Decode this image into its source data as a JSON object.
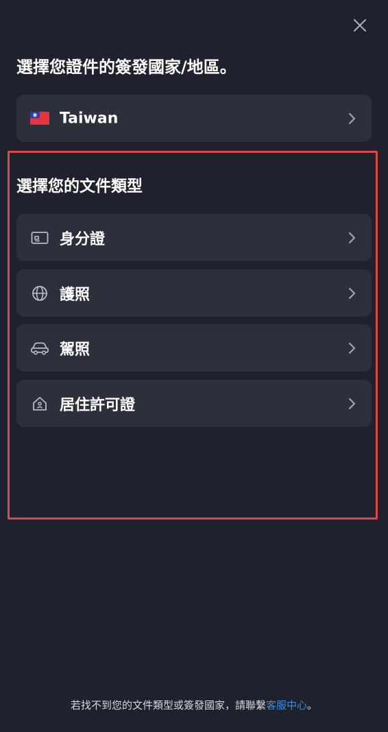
{
  "country_section": {
    "title": "選擇您證件的簽發國家/地區。",
    "selected_country": {
      "name": "Taiwan",
      "icon": "taiwan-flag-icon"
    }
  },
  "document_section": {
    "title": "選擇您的文件類型",
    "items": [
      {
        "label": "身分證",
        "icon": "id-card-icon"
      },
      {
        "label": "護照",
        "icon": "globe-icon"
      },
      {
        "label": "駕照",
        "icon": "car-icon"
      },
      {
        "label": "居住許可證",
        "icon": "house-icon"
      }
    ]
  },
  "footer": {
    "text": "若找不到您的文件類型或簽發國家，請聯繫",
    "link_text": "客服中心",
    "suffix": "。"
  },
  "colors": {
    "background": "#1f222c",
    "row": "#2d303b",
    "highlight": "#e0474b",
    "link": "#3a8ce6"
  }
}
